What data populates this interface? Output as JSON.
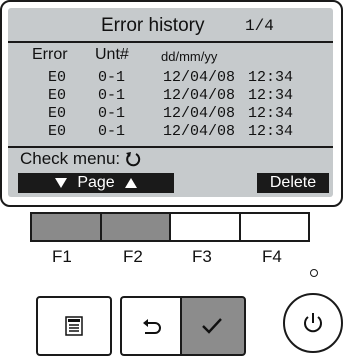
{
  "screen": {
    "title": "Error history",
    "page_indicator": "1/4",
    "columns": {
      "error": "Error",
      "unit": "Unt#",
      "date": "dd/mm/yy"
    },
    "rows": [
      {
        "error": "E0",
        "unit": "0-1",
        "date": "12/04/08",
        "time": "12:34"
      },
      {
        "error": "E0",
        "unit": "0-1",
        "date": "12/04/08",
        "time": "12:34"
      },
      {
        "error": "E0",
        "unit": "0-1",
        "date": "12/04/08",
        "time": "12:34"
      },
      {
        "error": "E0",
        "unit": "0-1",
        "date": "12/04/08",
        "time": "12:34"
      }
    ],
    "check_menu_label": "Check menu:",
    "page_label": "Page",
    "delete_label": "Delete"
  },
  "function_keys": [
    {
      "label": "F1",
      "shaded": true
    },
    {
      "label": "F2",
      "shaded": true
    },
    {
      "label": "F3",
      "shaded": false
    },
    {
      "label": "F4",
      "shaded": false
    }
  ],
  "buttons": {
    "menu": "menu-icon",
    "back": "return-icon",
    "confirm": "check-icon",
    "power": "power-icon"
  },
  "colors": {
    "lcd_background": "#c6cacc",
    "shaded_key": "#8a8a8a",
    "confirm_button": "#8c8c8c"
  }
}
